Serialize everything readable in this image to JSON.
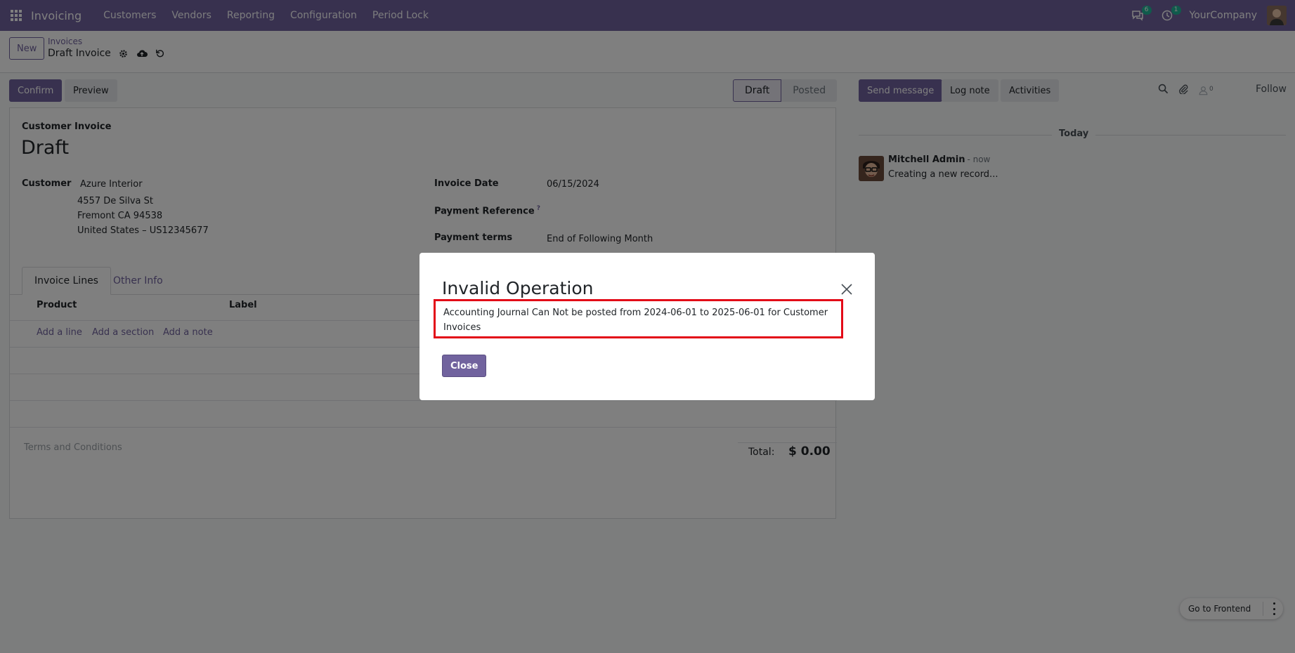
{
  "topnav": {
    "app_name": "Invoicing",
    "menu": [
      "Customers",
      "Vendors",
      "Reporting",
      "Configuration",
      "Period Lock"
    ],
    "messages_count": "6",
    "activities_count": "1",
    "company": "YourCompany"
  },
  "control_panel": {
    "new_label": "New",
    "breadcrumb": "Invoices",
    "record_title": "Draft Invoice"
  },
  "form": {
    "confirm_label": "Confirm",
    "preview_label": "Preview",
    "status": {
      "draft": "Draft",
      "posted": "Posted",
      "active": "Draft"
    },
    "doc_type": "Customer Invoice",
    "doc_name": "Draft",
    "customer_label": "Customer",
    "customer_name": "Azure Interior",
    "customer_address": [
      "4557 De Silva St",
      "Fremont CA 94538",
      "United States – US12345677"
    ],
    "invoice_date_label": "Invoice Date",
    "invoice_date": "06/15/2024",
    "payment_reference_label": "Payment Reference",
    "payment_reference_help": "?",
    "payment_terms_label": "Payment terms",
    "payment_terms": "End of Following Month",
    "tabs": [
      "Invoice Lines",
      "Other Info"
    ],
    "columns": [
      "Product",
      "Label"
    ],
    "add_links": [
      "Add a line",
      "Add a section",
      "Add a note"
    ],
    "terms_placeholder": "Terms and Conditions",
    "total_label": "Total:",
    "total_value": "$ 0.00"
  },
  "chatter": {
    "send_message_label": "Send message",
    "log_note_label": "Log note",
    "activities_label": "Activities",
    "followers_count": "0",
    "follow_label": "Follow",
    "today_label": "Today",
    "message": {
      "author": "Mitchell Admin",
      "time": "- now",
      "body": "Creating a new record..."
    }
  },
  "frontend": {
    "label": "Go to Frontend"
  },
  "dialog": {
    "title": "Invalid Operation",
    "message": "Accounting Journal Can Not be posted from 2024-06-01 to 2025-06-01 for Customer Invoices",
    "close_label": "Close",
    "highlight_color": "#e30a18"
  },
  "colors": {
    "brand": "#71639e",
    "badge": "#21b799"
  }
}
